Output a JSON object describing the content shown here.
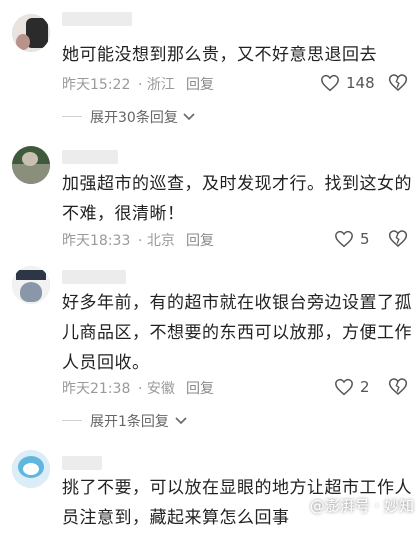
{
  "comments": [
    {
      "text": "她可能没想到那么贵，又不好意思退回去",
      "time": "昨天15:22",
      "location": "· 浙江",
      "reply": "回复",
      "likes": "148",
      "expand": "展开30条回复"
    },
    {
      "text": "加强超市的巡查，及时发现才行。找到这女的不难，很清晰！",
      "time": "昨天18:33",
      "location": "· 北京",
      "reply": "回复",
      "likes": "5"
    },
    {
      "text": "好多年前，有的超市就在收银台旁边设置了孤儿商品区，不想要的东西可以放那，方便工作人员回收。",
      "time": "昨天21:38",
      "location": "· 安徽",
      "reply": "回复",
      "likes": "2",
      "expand": "展开1条回复"
    },
    {
      "text": "挑了不要，可以放在显眼的地方让超市工作人员注意到，藏起来算怎么回事"
    }
  ],
  "watermark": "@澎湃号 · 妙知",
  "icons": {
    "like": "heart-outline-icon",
    "dislike": "broken-heart-icon",
    "expand": "chevron-down-icon"
  },
  "colors": {
    "meta": "#9a9a9a",
    "text": "#222222",
    "divider": "#d0d0d0"
  }
}
